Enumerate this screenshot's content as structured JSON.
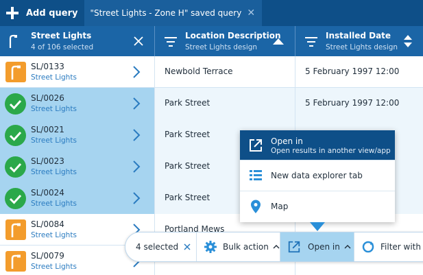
{
  "tabbar": {
    "add_query_label": "Add query",
    "active_tab_label": "\"Street Lights - Zone H\" saved query"
  },
  "header": {
    "col1": {
      "title": "Street Lights",
      "subtitle": "4 of 106 selected"
    },
    "col2": {
      "title": "Location Description",
      "subtitle": "Street Lights design"
    },
    "col3": {
      "title": "Installed Date",
      "subtitle": "Street Lights design"
    }
  },
  "rows": [
    {
      "id": "SL/0133",
      "type": "Street Lights",
      "location": "Newbold Terrace",
      "installed": "5 February 1997 12:00",
      "selected": false
    },
    {
      "id": "SL/0026",
      "type": "Street Lights",
      "location": "Park Street",
      "installed": "5 February 1997 12:00",
      "selected": true
    },
    {
      "id": "SL/0021",
      "type": "Street Lights",
      "location": "Park Street",
      "installed": "",
      "selected": true
    },
    {
      "id": "SL/0023",
      "type": "Street Lights",
      "location": "Park Street",
      "installed": "",
      "selected": true
    },
    {
      "id": "SL/0024",
      "type": "Street Lights",
      "location": "Park Street",
      "installed": "",
      "selected": true
    },
    {
      "id": "SL/0084",
      "type": "Street Lights",
      "location": "Portland Mews",
      "installed": "",
      "selected": false
    },
    {
      "id": "SL/0079",
      "type": "Street Lights",
      "location": "",
      "installed": "",
      "selected": false
    }
  ],
  "menu": {
    "open_in": {
      "label": "Open in",
      "sublabel": "Open results in another view/app"
    },
    "new_tab": {
      "label": "New data explorer tab"
    },
    "map": {
      "label": "Map"
    }
  },
  "actionbar": {
    "selected_label": "4 selected",
    "bulk_label": "Bulk action",
    "open_label": "Open in",
    "filter_label": "Filter with A"
  },
  "colors": {
    "tabbar": "#0e4f88",
    "header": "#1b65a6",
    "selected_row": "#a6d4f0",
    "badge_orange": "#f39c2c",
    "badge_check": "#2ba84a",
    "accent": "#2a7bc0"
  }
}
